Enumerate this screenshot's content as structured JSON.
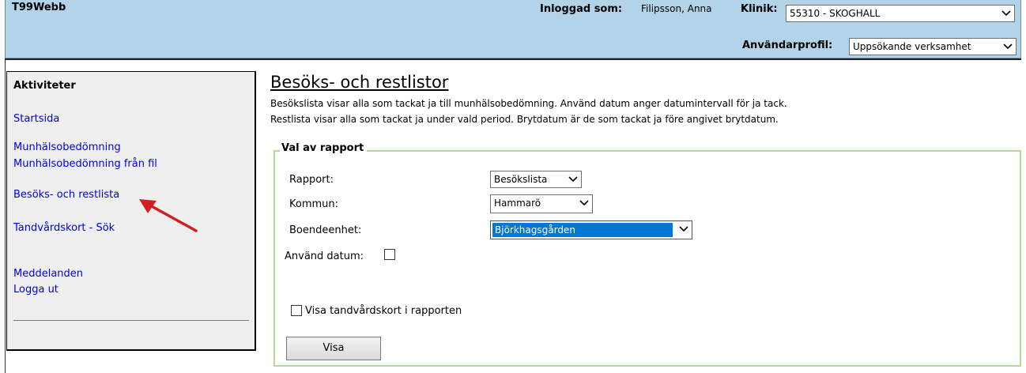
{
  "header": {
    "app_title": "T99Webb",
    "logged_in_label": "Inloggad som:",
    "logged_in_user": "Filipsson, Anna",
    "klinik_label": "Klinik:",
    "klinik_value": "55310 - SKOGHALL",
    "profile_label": "Användarprofil:",
    "profile_value": "Uppsökande verksamhet"
  },
  "sidebar": {
    "heading": "Aktiviteter",
    "links": [
      "Startsida",
      "Munhälsobedömning",
      "Munhälsobedömning från fil",
      "Besöks- och restlista",
      "Tandvårdskort - Sök",
      "Meddelanden",
      "Logga ut"
    ]
  },
  "main": {
    "title": "Besöks- och restlistor",
    "desc_line1": "Besökslista visar alla som tackat ja till munhälsobedömning. Använd datum anger datumintervall för ja tack.",
    "desc_line2": "Restlista visar alla som tackat ja under vald period. Brytdatum är de som tackat ja före angivet brytdatum.",
    "form": {
      "legend": "Val av rapport",
      "rapport_label": "Rapport:",
      "rapport_value": "Besökslista",
      "kommun_label": "Kommun:",
      "kommun_value": "Hammarö",
      "boende_label": "Boendeenhet:",
      "boende_value": "Björkhagsgården",
      "use_date_label": "Använd datum:",
      "use_date_checked": false,
      "show_card_label": "Visa tandvårdskort i rapporten",
      "show_card_checked": false,
      "submit_label": "Visa"
    }
  },
  "colors": {
    "header_bg": "#b3d4e8",
    "link": "#0000e8",
    "fieldset_border": "#b8d89a",
    "selection": "#0078d7",
    "annotation_arrow": "#d02020"
  }
}
